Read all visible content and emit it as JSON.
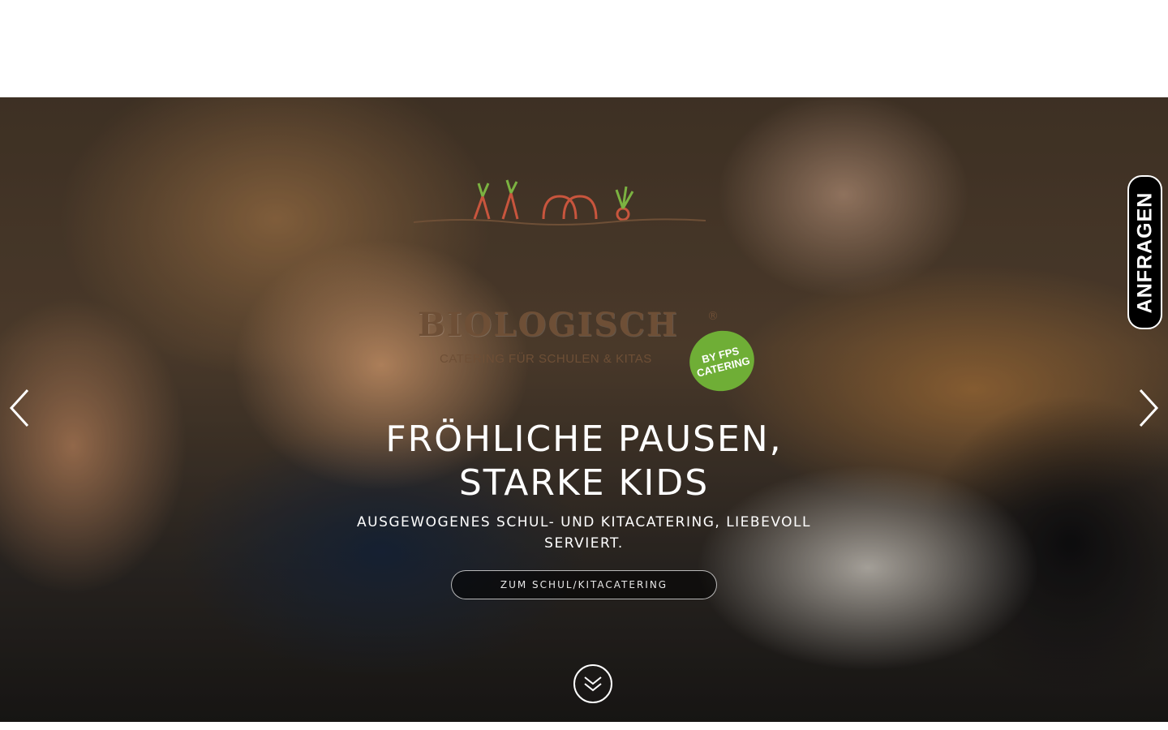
{
  "logo": {
    "wordmark": "BIOLOGISCH",
    "registered": "®",
    "tagline": "CATERING FÜR SCHULEN & KITAS",
    "badge_line1": "BY FPS",
    "badge_line2": "CATERING"
  },
  "hero": {
    "title_line1": "FRÖHLICHE PAUSEN,",
    "title_line2": "STARKE KIDS",
    "subtitle": "AUSGEWOGENES SCHUL- UND KITACATERING, LIEBEVOLL SERVIERT.",
    "cta_label": "ZUM SCHUL/KITACATERING"
  },
  "carousel": {
    "prev_icon": "chevron-left-icon",
    "next_icon": "chevron-right-icon"
  },
  "scroll": {
    "icon": "double-chevron-down-icon"
  },
  "side_tab": {
    "label": "ANFRAGEN"
  },
  "colors": {
    "logo_brown": "#6e4f36",
    "badge_green": "#6fae36",
    "tab_background": "#000000",
    "text_white": "#ffffff"
  }
}
